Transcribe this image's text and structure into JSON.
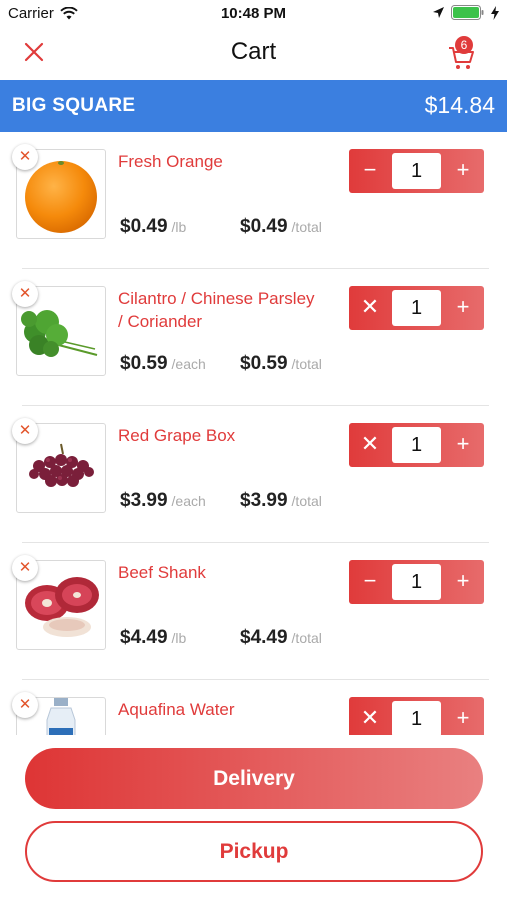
{
  "status_bar": {
    "carrier": "Carrier",
    "time": "10:48 PM"
  },
  "nav": {
    "title": "Cart",
    "cart_badge": "6"
  },
  "store": {
    "name": "BIG SQUARE",
    "total": "$14.84"
  },
  "colors": {
    "accent": "#e03b3b",
    "store_bar": "#3b7fe0"
  },
  "items": [
    {
      "name": "Fresh Orange",
      "unit_price": "$0.49",
      "unit": "/lb",
      "total_price": "$0.49",
      "total_suffix": "/total",
      "quantity": "1",
      "minus_symbol": "−",
      "plus_symbol": "+",
      "remove_symbol": "✕",
      "image_icon": "orange-icon"
    },
    {
      "name": "Cilantro / Chinese Parsley / Coriander",
      "unit_price": "$0.59",
      "unit": "/each",
      "total_price": "$0.59",
      "total_suffix": "/total",
      "quantity": "1",
      "minus_symbol": "✕",
      "plus_symbol": "+",
      "remove_symbol": "✕",
      "image_icon": "cilantro-icon"
    },
    {
      "name": "Red Grape Box",
      "unit_price": "$3.99",
      "unit": "/each",
      "total_price": "$3.99",
      "total_suffix": "/total",
      "quantity": "1",
      "minus_symbol": "✕",
      "plus_symbol": "+",
      "remove_symbol": "✕",
      "image_icon": "grapes-icon"
    },
    {
      "name": "Beef Shank",
      "unit_price": "$4.49",
      "unit": "/lb",
      "total_price": "$4.49",
      "total_suffix": "/total",
      "quantity": "1",
      "minus_symbol": "−",
      "plus_symbol": "+",
      "remove_symbol": "✕",
      "image_icon": "beef-icon"
    },
    {
      "name": "Aquafina Water",
      "quantity": "1",
      "minus_symbol": "✕",
      "plus_symbol": "+",
      "remove_symbol": "✕",
      "image_icon": "water-bottle-icon"
    }
  ],
  "buttons": {
    "delivery": "Delivery",
    "pickup": "Pickup"
  }
}
